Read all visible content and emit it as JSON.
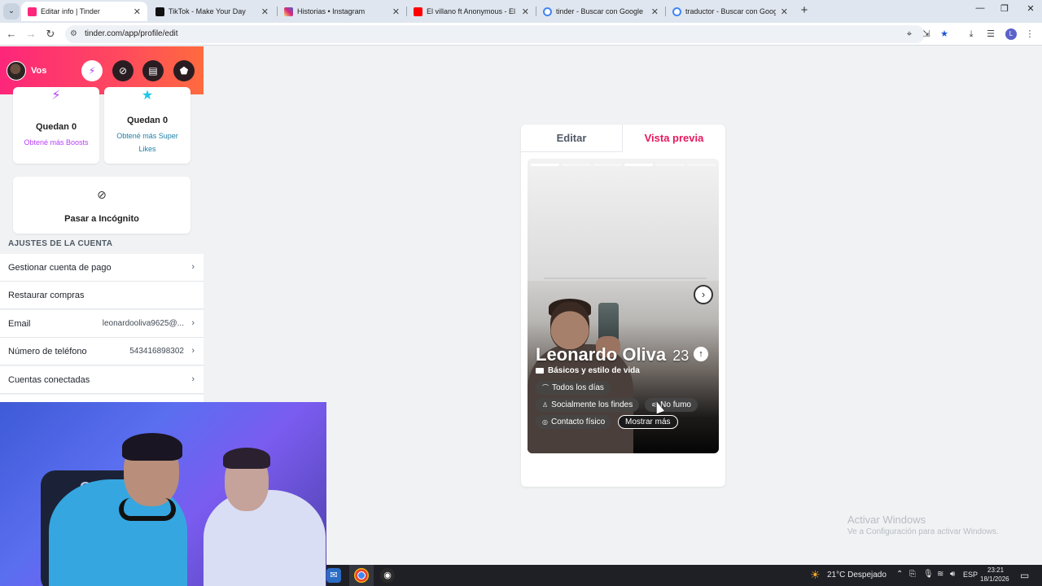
{
  "browser": {
    "tabs": [
      {
        "title": "Editar info | Tinder",
        "active": true,
        "favicon_color": "#fd267a"
      },
      {
        "title": "TikTok - Make Your Day",
        "active": false,
        "favicon_color": "#111111"
      },
      {
        "title": "Historias • Instagram",
        "active": false,
        "favicon_color": "#d6249f"
      },
      {
        "title": "El villano ft Anonymous - El tei",
        "active": false,
        "favicon_color": "#ff0000"
      },
      {
        "title": "tinder - Buscar con Google",
        "active": false,
        "favicon_color": "#4285f4"
      },
      {
        "title": "traductor - Buscar con Google",
        "active": false,
        "favicon_color": "#4285f4"
      }
    ],
    "url": "tinder.com/app/profile/edit",
    "profile_initial": "L"
  },
  "sidebar": {
    "user_name": "Vos",
    "header_buttons": [
      {
        "name": "boost-icon",
        "glyph": "⚡"
      },
      {
        "name": "compass-icon",
        "glyph": "⊘"
      },
      {
        "name": "briefcase-icon",
        "glyph": "▤"
      },
      {
        "name": "shield-icon",
        "glyph": "⬟"
      }
    ],
    "boosts": {
      "count_label": "Quedan 0",
      "link": "Obtené más Boosts"
    },
    "super_likes": {
      "count_label": "Quedan 0",
      "link_line1": "Obtené más Super",
      "link_line2": "Likes"
    },
    "incognito": {
      "label": "Pasar a Incógnito"
    },
    "account_section_title": "AJUSTES DE LA CUENTA",
    "rows": [
      {
        "label": "Gestionar cuenta de pago",
        "value": "",
        "chevron": true
      },
      {
        "label": "Restaurar compras",
        "value": "",
        "chevron": false
      },
      {
        "label": "Email",
        "value": "leonardooliva9625@...",
        "chevron": true
      },
      {
        "label": "Número de teléfono",
        "value": "543416898302",
        "chevron": true
      },
      {
        "label": "Cuentas conectadas",
        "value": "",
        "chevron": true
      }
    ]
  },
  "preview": {
    "tab_edit": "Editar",
    "tab_preview": "Vista previa",
    "name": "Leonardo Oliva",
    "age": "23",
    "basics_label": "Básicos y estilo de vida",
    "chips": {
      "drinking": "Todos los días",
      "social": "Socialmente los findes",
      "smoking": "No fumo",
      "love_language": "Contacto físico",
      "more": "Mostrar más"
    }
  },
  "watermark": {
    "title": "Activar Windows",
    "subtitle": "Ve a Configuración para activar Windows."
  },
  "taskbar": {
    "weather": "21°C  Despejado",
    "lang": "ESP",
    "time": "23:21",
    "date": "18/1/2026"
  },
  "colors": {
    "tinder_pink": "#fd267a",
    "preview_accent": "#e8185e",
    "boost_purple": "#b53ef5",
    "superlike_blue": "#1ec8e8"
  }
}
